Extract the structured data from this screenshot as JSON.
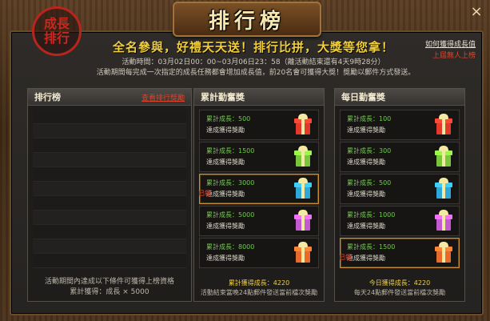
{
  "window": {
    "title": "排行榜",
    "close": "×"
  },
  "seal": {
    "line1": "成長",
    "line2": "排行"
  },
  "header": {
    "slogan": "全名參與，好禮天天送！排行比拼，大獎等您拿！",
    "time": "活動時間：03月02日00：00~03月06日23：58（離活動結束還有4天9時28分）",
    "desc": "活動期間每完成一次指定的成長任務都會增加成長值，前20名會可獲得大獎！獎勵以郵件方式發送。",
    "how_link": "如何獲得成長值",
    "last_champion": "上屆無人上榜"
  },
  "ranking": {
    "title": "排行榜",
    "view_link": "查看排行獎勵",
    "rows": 11,
    "footer_line1": "活動期間內達成以下條件可獲得上榜資格",
    "footer_line2": "累計獲得：成長 × 5000"
  },
  "cumulative": {
    "title": "累計勤奮獎",
    "items": [
      {
        "line1": "累計成長：500",
        "line2": "達成獲得獎勵",
        "color": "#e23a2a",
        "selected": false,
        "stamp": ""
      },
      {
        "line1": "累計成長：1500",
        "line2": "達成獲得獎勵",
        "color": "#7ac63a",
        "selected": false,
        "stamp": ""
      },
      {
        "line1": "累計成長：3000",
        "line2": "達成獲得獎勵",
        "color": "#2fa7d8",
        "selected": true,
        "stamp": "已領"
      },
      {
        "line1": "累計成長：5000",
        "line2": "達成獲得獎勵",
        "color": "#c45ad0",
        "selected": false,
        "stamp": ""
      },
      {
        "line1": "累計成長：8000",
        "line2": "達成獲得獎勵",
        "color": "#e86a2a",
        "selected": false,
        "stamp": ""
      }
    ],
    "footer_a": "累計獲得成長：4220",
    "footer_b": "活動結束當晚24點郵件發送當前檔次獎勵"
  },
  "daily": {
    "title": "每日勤奮獎",
    "items": [
      {
        "line1": "累計成長：100",
        "line2": "達成獲得獎勵",
        "color": "#e23a2a",
        "selected": false,
        "stamp": ""
      },
      {
        "line1": "累計成長：300",
        "line2": "達成獲得獎勵",
        "color": "#7ac63a",
        "selected": false,
        "stamp": ""
      },
      {
        "line1": "累計成長：500",
        "line2": "達成獲得獎勵",
        "color": "#2fa7d8",
        "selected": false,
        "stamp": ""
      },
      {
        "line1": "累計成長：1000",
        "line2": "達成獲得獎勵",
        "color": "#c45ad0",
        "selected": false,
        "stamp": ""
      },
      {
        "line1": "累計成長：1500",
        "line2": "達成獲得獎勵",
        "color": "#e86a2a",
        "selected": true,
        "stamp": "已領"
      }
    ],
    "footer_a": "今日獲得成長：4220",
    "footer_b": "每天24點郵件發送當前檔次獎勵"
  }
}
